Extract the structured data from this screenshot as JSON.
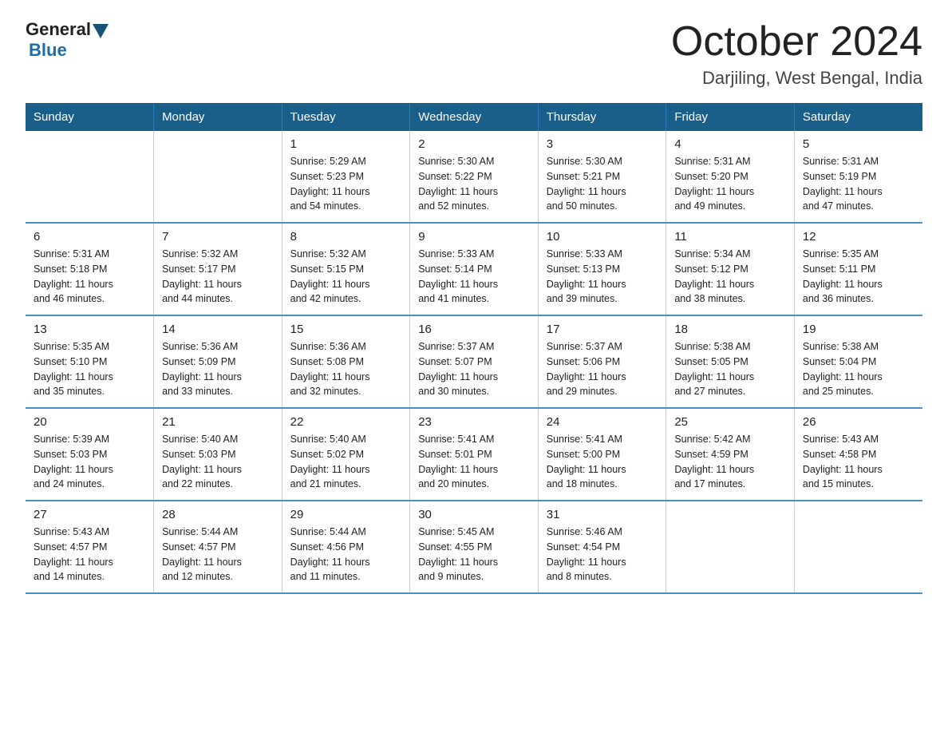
{
  "logo": {
    "general": "General",
    "blue": "Blue"
  },
  "header": {
    "month": "October 2024",
    "location": "Darjiling, West Bengal, India"
  },
  "weekdays": [
    "Sunday",
    "Monday",
    "Tuesday",
    "Wednesday",
    "Thursday",
    "Friday",
    "Saturday"
  ],
  "weeks": [
    [
      {
        "day": "",
        "info": ""
      },
      {
        "day": "",
        "info": ""
      },
      {
        "day": "1",
        "info": "Sunrise: 5:29 AM\nSunset: 5:23 PM\nDaylight: 11 hours\nand 54 minutes."
      },
      {
        "day": "2",
        "info": "Sunrise: 5:30 AM\nSunset: 5:22 PM\nDaylight: 11 hours\nand 52 minutes."
      },
      {
        "day": "3",
        "info": "Sunrise: 5:30 AM\nSunset: 5:21 PM\nDaylight: 11 hours\nand 50 minutes."
      },
      {
        "day": "4",
        "info": "Sunrise: 5:31 AM\nSunset: 5:20 PM\nDaylight: 11 hours\nand 49 minutes."
      },
      {
        "day": "5",
        "info": "Sunrise: 5:31 AM\nSunset: 5:19 PM\nDaylight: 11 hours\nand 47 minutes."
      }
    ],
    [
      {
        "day": "6",
        "info": "Sunrise: 5:31 AM\nSunset: 5:18 PM\nDaylight: 11 hours\nand 46 minutes."
      },
      {
        "day": "7",
        "info": "Sunrise: 5:32 AM\nSunset: 5:17 PM\nDaylight: 11 hours\nand 44 minutes."
      },
      {
        "day": "8",
        "info": "Sunrise: 5:32 AM\nSunset: 5:15 PM\nDaylight: 11 hours\nand 42 minutes."
      },
      {
        "day": "9",
        "info": "Sunrise: 5:33 AM\nSunset: 5:14 PM\nDaylight: 11 hours\nand 41 minutes."
      },
      {
        "day": "10",
        "info": "Sunrise: 5:33 AM\nSunset: 5:13 PM\nDaylight: 11 hours\nand 39 minutes."
      },
      {
        "day": "11",
        "info": "Sunrise: 5:34 AM\nSunset: 5:12 PM\nDaylight: 11 hours\nand 38 minutes."
      },
      {
        "day": "12",
        "info": "Sunrise: 5:35 AM\nSunset: 5:11 PM\nDaylight: 11 hours\nand 36 minutes."
      }
    ],
    [
      {
        "day": "13",
        "info": "Sunrise: 5:35 AM\nSunset: 5:10 PM\nDaylight: 11 hours\nand 35 minutes."
      },
      {
        "day": "14",
        "info": "Sunrise: 5:36 AM\nSunset: 5:09 PM\nDaylight: 11 hours\nand 33 minutes."
      },
      {
        "day": "15",
        "info": "Sunrise: 5:36 AM\nSunset: 5:08 PM\nDaylight: 11 hours\nand 32 minutes."
      },
      {
        "day": "16",
        "info": "Sunrise: 5:37 AM\nSunset: 5:07 PM\nDaylight: 11 hours\nand 30 minutes."
      },
      {
        "day": "17",
        "info": "Sunrise: 5:37 AM\nSunset: 5:06 PM\nDaylight: 11 hours\nand 29 minutes."
      },
      {
        "day": "18",
        "info": "Sunrise: 5:38 AM\nSunset: 5:05 PM\nDaylight: 11 hours\nand 27 minutes."
      },
      {
        "day": "19",
        "info": "Sunrise: 5:38 AM\nSunset: 5:04 PM\nDaylight: 11 hours\nand 25 minutes."
      }
    ],
    [
      {
        "day": "20",
        "info": "Sunrise: 5:39 AM\nSunset: 5:03 PM\nDaylight: 11 hours\nand 24 minutes."
      },
      {
        "day": "21",
        "info": "Sunrise: 5:40 AM\nSunset: 5:03 PM\nDaylight: 11 hours\nand 22 minutes."
      },
      {
        "day": "22",
        "info": "Sunrise: 5:40 AM\nSunset: 5:02 PM\nDaylight: 11 hours\nand 21 minutes."
      },
      {
        "day": "23",
        "info": "Sunrise: 5:41 AM\nSunset: 5:01 PM\nDaylight: 11 hours\nand 20 minutes."
      },
      {
        "day": "24",
        "info": "Sunrise: 5:41 AM\nSunset: 5:00 PM\nDaylight: 11 hours\nand 18 minutes."
      },
      {
        "day": "25",
        "info": "Sunrise: 5:42 AM\nSunset: 4:59 PM\nDaylight: 11 hours\nand 17 minutes."
      },
      {
        "day": "26",
        "info": "Sunrise: 5:43 AM\nSunset: 4:58 PM\nDaylight: 11 hours\nand 15 minutes."
      }
    ],
    [
      {
        "day": "27",
        "info": "Sunrise: 5:43 AM\nSunset: 4:57 PM\nDaylight: 11 hours\nand 14 minutes."
      },
      {
        "day": "28",
        "info": "Sunrise: 5:44 AM\nSunset: 4:57 PM\nDaylight: 11 hours\nand 12 minutes."
      },
      {
        "day": "29",
        "info": "Sunrise: 5:44 AM\nSunset: 4:56 PM\nDaylight: 11 hours\nand 11 minutes."
      },
      {
        "day": "30",
        "info": "Sunrise: 5:45 AM\nSunset: 4:55 PM\nDaylight: 11 hours\nand 9 minutes."
      },
      {
        "day": "31",
        "info": "Sunrise: 5:46 AM\nSunset: 4:54 PM\nDaylight: 11 hours\nand 8 minutes."
      },
      {
        "day": "",
        "info": ""
      },
      {
        "day": "",
        "info": ""
      }
    ]
  ]
}
